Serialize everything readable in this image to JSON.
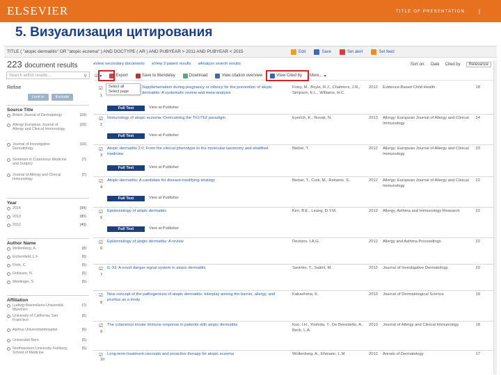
{
  "slide": {
    "brand": "ELSEVIER",
    "presentation_title": "TITLE OF PRESENTATION",
    "page_number": "|",
    "title": "5. Визуализация цитирования"
  },
  "query": "TITLE ( \"atopic dermatitis\" OR \"atopic eczema\" ) AND DOCTYPE ( AR ) AND PUBYEAR > 2011 AND PUBYEAR < 2015",
  "query_tools": [
    "Edit",
    "Save",
    "Set alert",
    "Set feed"
  ],
  "results_count": "223",
  "results_label": "document results",
  "top_links": [
    "View secondary documents",
    "View 3 patent results",
    "Analyze search results"
  ],
  "sort": {
    "label": "Sort on:",
    "options": [
      "Date",
      "Cited by",
      "Relevance"
    ]
  },
  "search_placeholder": "Search within results...",
  "toolbar": [
    "All",
    "Export",
    "Save to Mendeley",
    "Download",
    "View citation overview",
    "View Cited by",
    "More..."
  ],
  "select_menu": [
    "Select all",
    "Select page"
  ],
  "sidebar": {
    "refine": "Refine",
    "limit": "Limit to",
    "exclude": "Exclude",
    "source": {
      "heading": "Source Title",
      "items": [
        {
          "name": "British Journal of Dermatology",
          "count": "(10)"
        },
        {
          "name": "Allergy European Journal of Allergy and Clinical Immunology",
          "count": "(10)"
        },
        {
          "name": "Journal of Investigative Dermatology",
          "count": "(10)"
        },
        {
          "name": "Seminars in Cutaneous Medicine and Surgery",
          "count": "(7)"
        },
        {
          "name": "Journal of Allergy and Clinical Immunology",
          "count": "(7)"
        }
      ]
    },
    "year": {
      "heading": "Year",
      "items": [
        {
          "name": "2014",
          "count": "(94)"
        },
        {
          "name": "2013",
          "count": "(80)"
        },
        {
          "name": "2012",
          "count": "(49)"
        }
      ]
    },
    "author": {
      "heading": "Author Name",
      "items": [
        {
          "name": "Wollenberg, A.",
          "count": "(8)"
        },
        {
          "name": "Eichenfield, L.F.",
          "count": "(6)"
        },
        {
          "name": "Flohr, C.",
          "count": "(5)"
        },
        {
          "name": "Dobsson, N.",
          "count": "(5)"
        },
        {
          "name": "Weidinger, S.",
          "count": "(5)"
        }
      ]
    },
    "affiliation": {
      "heading": "Affiliation",
      "items": [
        {
          "name": "Ludwig-Maximilians-Universität München",
          "count": "(7)"
        },
        {
          "name": "University of California, San Francisco",
          "count": "(6)"
        },
        {
          "name": "Aarhus Universitetshospital",
          "count": "(5)"
        },
        {
          "name": "Universität Bern",
          "count": "(5)"
        },
        {
          "name": "Northwestern University Feinberg School of Medicine",
          "count": "(5)"
        }
      ]
    }
  },
  "full_text_label": "Full Text",
  "view_publisher_label": "View at Publisher",
  "results": [
    {
      "n": "1",
      "title": "Supplementation during pregnancy or infancy for the prevention of atopic dermatitis: A systematic review and meta-analysis",
      "authors": "Foisy, M., Boyle, R.J., Chalmers, J.R., Simpson, E.L., Williams, H.C.",
      "year": "2012",
      "source": "Evidence-Based Child Health",
      "cites": "18"
    },
    {
      "n": "2",
      "title": "Immunology of atopic eczema: Overcoming the Th1/Th2 paradigm",
      "authors": "Eyerich, K., Novak, N.",
      "year": "2013",
      "source": "Allergy: European Journal of Allergy and Clinical Immunology",
      "cites": "24"
    },
    {
      "n": "3",
      "title": "Atopic dermatitis 2.0: From the clinical phenotype to the molecular taxonomy and stratified medicine",
      "authors": "Bieber, T.",
      "year": "2012",
      "source": "Allergy: European Journal of Allergy and Clinical Immunology",
      "cites": "23"
    },
    {
      "n": "4",
      "title": "Atopic dermatitis: A candidate for disease-modifying strategy",
      "authors": "Bieber, T., Cork, M., Reitamo, S.",
      "year": "2012",
      "source": "Allergy: European Journal of Allergy and Clinical Immunology",
      "cites": "22"
    },
    {
      "n": "5",
      "title": "Epidemiology of atopic dermatitis",
      "authors": "Kim, B.E., Leung, D.Y.M.",
      "year": "2012",
      "source": "Allergy, Asthma and Immunology Research",
      "cites": "22"
    },
    {
      "n": "6",
      "title": "Epidemiology of atopic dermatitis: A review",
      "authors": "Deckers, I.A.G.",
      "year": "2012",
      "source": "Allergy and Asthma Proceedings",
      "cites": "22"
    },
    {
      "n": "7",
      "title": "IL-33: A novel danger signal system in atopic dermatitis",
      "authors": "Savinko, T., Salimi, M.",
      "year": "2012",
      "source": "Journal of Investigative Dermatology",
      "cites": "22"
    },
    {
      "n": "8",
      "title": "New concept of the pathogenesis of atopic dermatitis: Interplay among the barrier, allergy, and pruritus as a trinity",
      "authors": "Kabashima, K.",
      "year": "2013",
      "source": "Journal of Dermatological Science",
      "cites": "19"
    },
    {
      "n": "9",
      "title": "The cutaneous innate immune response in patients with atopic dermatitis",
      "authors": "Kuo, I.H., Yoshida, T., De Benedetto, A., Beck, L.A.",
      "year": "2013",
      "source": "Journal of Allergy and Clinical Immunology",
      "cites": "18"
    },
    {
      "n": "10",
      "title": "Long-term treatment concepts and proactive therapy for atopic eczema",
      "authors": "Wollenberg, A., Ehmann, L.M.",
      "year": "2012",
      "source": "Annals of Dermatology",
      "cites": "17"
    }
  ],
  "colors": {
    "topbar": "#e8711f",
    "title": "#1b3f8a",
    "highlight": "#d2232a",
    "fulltext": "#1e3f7a",
    "link": "#2a5db0"
  },
  "icons": {
    "edit": "pencil-icon",
    "save": "save-icon",
    "alert": "bell-icon",
    "feed": "rss-icon"
  }
}
